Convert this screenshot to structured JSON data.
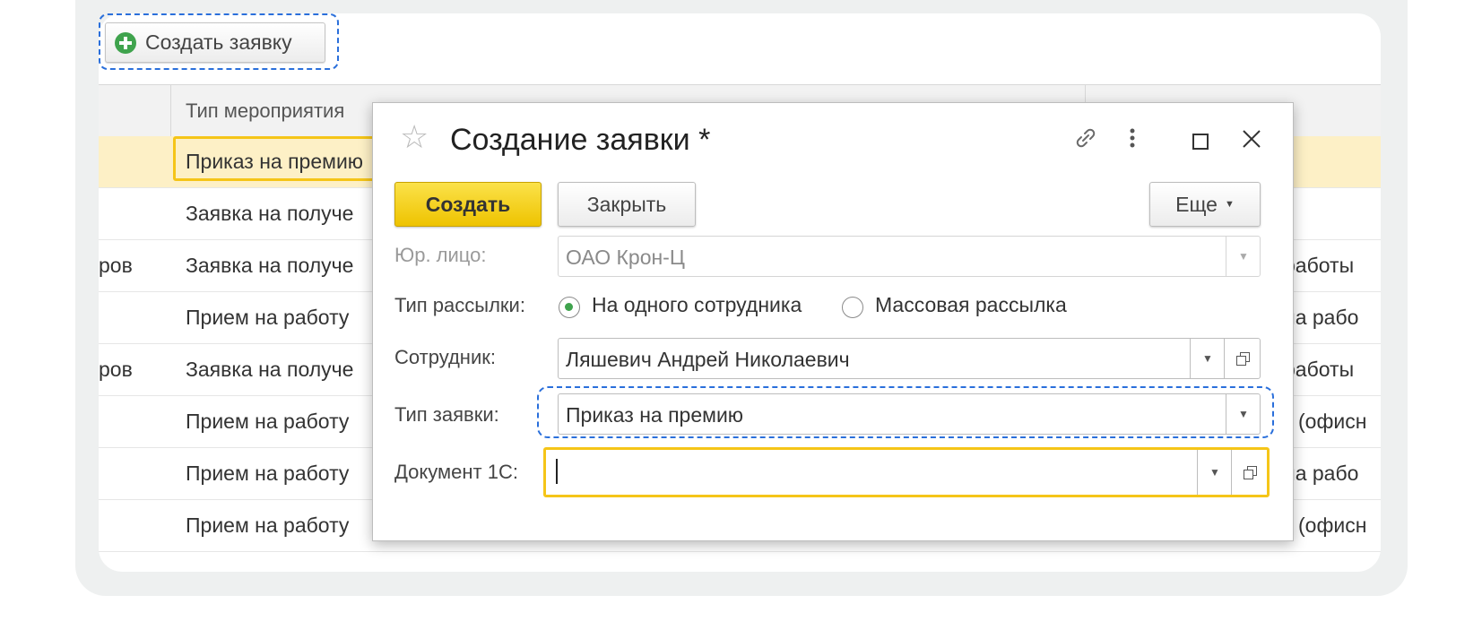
{
  "toolbar": {
    "create_request_label": "Создать заявку"
  },
  "table": {
    "headers": [
      "Тип мероприятия"
    ],
    "rows": [
      {
        "left": "",
        "event": "Приказ на премию",
        "right": ""
      },
      {
        "left": "",
        "event": "Заявка на получе",
        "right": ""
      },
      {
        "left": "ров",
        "event": "Заявка на получе",
        "right": "работы"
      },
      {
        "left": "",
        "event": "Прием на работу",
        "right": "на рабо"
      },
      {
        "left": "ров",
        "event": "Заявка на получе",
        "right": "работы"
      },
      {
        "left": "",
        "event": "Прием на работу",
        "right": "(офисн"
      },
      {
        "left": "",
        "event": "Прием на работу",
        "right": "на рабо"
      },
      {
        "left": "",
        "event": "Прием на работу",
        "right": "(офисн"
      }
    ]
  },
  "modal": {
    "title": "Создание заявки *",
    "create_label": "Создать",
    "close_label": "Закрыть",
    "more_label": "Еще",
    "form": {
      "legal_entity": {
        "label": "Юр. лицо:",
        "value": "ОАО Крон-Ц"
      },
      "mailing_type": {
        "label": "Тип рассылки:",
        "options": [
          "На одного сотрудника",
          "Массовая рассылка"
        ],
        "selected": "На одного сотрудника"
      },
      "employee": {
        "label": "Сотрудник:",
        "value": "Ляшевич Андрей Николаевич"
      },
      "request_type": {
        "label": "Тип заявки:",
        "value": "Приказ на премию"
      },
      "document_1c": {
        "label": "Документ 1С:",
        "value": ""
      }
    }
  },
  "colors": {
    "accent_yellow": "#f5c518",
    "focus_blue": "#2a6fdb",
    "radio_green": "#3fa34d"
  }
}
